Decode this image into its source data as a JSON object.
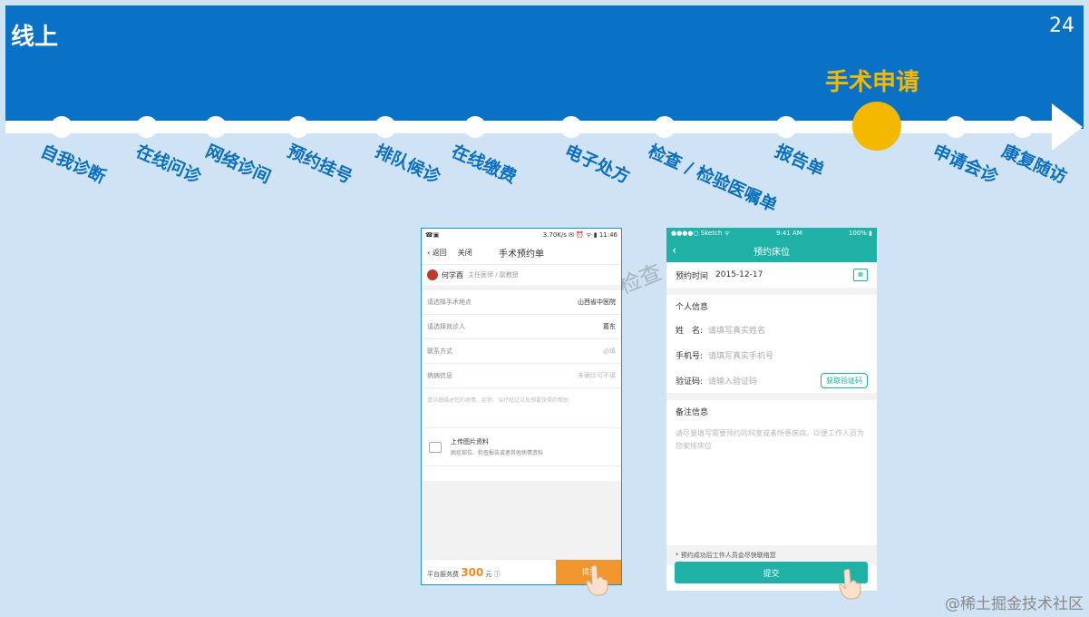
{
  "slide": {
    "title": "线上",
    "number": "24"
  },
  "timeline": {
    "active_label": "手术申请",
    "steps": [
      "自我诊断",
      "在线问诊",
      "网络诊间",
      "预约挂号",
      "排队候诊",
      "在线缴费",
      "电子处方",
      "检查 / 检验医嘱单",
      "报告单",
      "申请会诊",
      "康复随访"
    ]
  },
  "watermark": "检查  术",
  "footer_watermark": "@稀土掘金技术社区",
  "phone1": {
    "status_left": "☎▣",
    "status_right": "3.70K/s ✉ ⏰ ᯤ ▮ 11:46",
    "back_label": "返回",
    "close_label": "关闭",
    "title": "手术预约单",
    "doctor_name": "何学酉",
    "doctor_title": "主任医师 / 副教授",
    "rows": [
      {
        "label": "请选择手术地点",
        "value": "山西省中医院"
      },
      {
        "label": "请选择就诊人",
        "value": "葛东"
      },
      {
        "label": "联系方式",
        "value": "必填"
      },
      {
        "label": "病病信息",
        "value": "未确诊可不填"
      }
    ],
    "desc_placeholder": "请详细描述您的病情、症状、治疗经过以及想要获得的帮助",
    "upload_title": "上传图片资料",
    "upload_sub": "病症部位、检查报告或者其他病情资料",
    "fee_label": "平台服务费",
    "fee_amount": "300",
    "fee_unit": "元",
    "submit_label": "提交"
  },
  "phone2": {
    "status_left": "●●●●○ Sketch ᯤ",
    "status_time": "9:41 AM",
    "status_right": "100% ▮",
    "title": "预约床位",
    "time_label": "预约时间",
    "time_value": "2015-12-17",
    "personal_label": "个人信息",
    "name_label": "姓　名:",
    "name_placeholder": "请填写真实姓名",
    "phone_label": "手机号:",
    "phone_placeholder": "请填写真实手机号",
    "code_label": "验证码:",
    "code_placeholder": "请输入验证码",
    "code_button": "获取验证码",
    "note_label": "备注信息",
    "note_placeholder": "请尽量填写需要预约的科室或者所患疾病，以便工作人员为您安排床位",
    "tip": "* 预约成功后工作人员会尽快联络您",
    "submit_label": "提交"
  },
  "colors": {
    "header": "#0a72c6",
    "active": "#f5b800",
    "teal": "#1fb1a5",
    "orange": "#f0962d"
  }
}
